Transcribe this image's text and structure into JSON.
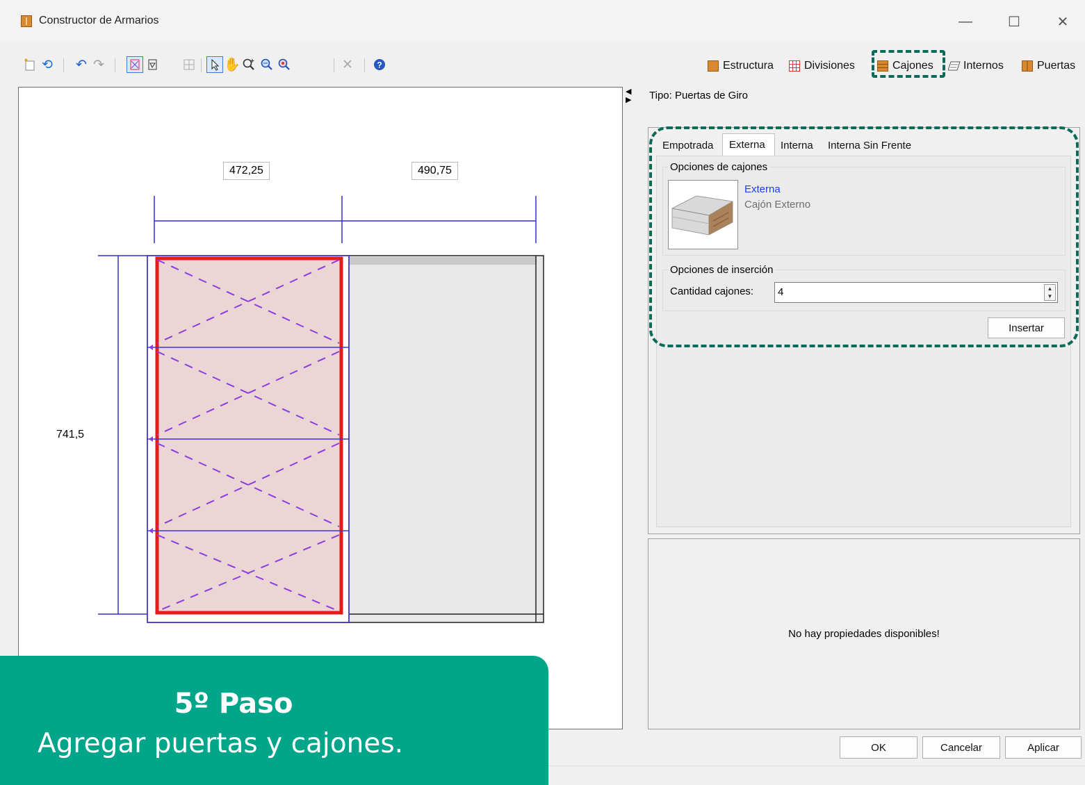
{
  "window": {
    "title": "Constructor de Armarios",
    "minimize": "—",
    "maximize": "☐",
    "close": "✕"
  },
  "toolbar": {
    "tabs": [
      {
        "label": "Estructura"
      },
      {
        "label": "Divisiones"
      },
      {
        "label": "Cajones"
      },
      {
        "label": "Internos"
      },
      {
        "label": "Puertas"
      }
    ]
  },
  "canvas": {
    "dim_top_left": "472,25",
    "dim_top_right": "490,75",
    "dim_left": "741,5"
  },
  "panel": {
    "tipo": "Tipo: Puertas de Giro",
    "tabs": [
      "Empotrada",
      "Externa",
      "Interna",
      "Interna Sin Frente"
    ],
    "active_tab": "Externa",
    "group_drawer_options": "Opciones de cajones",
    "drawer_name": "Externa",
    "drawer_desc": "Cajón Externo",
    "group_insert_options": "Opciones de inserción",
    "qty_label": "Cantidad cajones:",
    "qty_value": "4",
    "insert_button": "Insertar",
    "props_message": "No hay propiedades disponibles!"
  },
  "buttons": {
    "ok": "OK",
    "cancel": "Cancelar",
    "apply": "Aplicar"
  },
  "callout": {
    "title": "5º Paso",
    "text": "Agregar puertas y cajones."
  },
  "colors": {
    "callout": "#00a58a",
    "highlight": "#0c6b57",
    "selection_red": "#e21b1b",
    "dimension_blue": "#2f2fd6",
    "drawer_purple": "#8a3ee0"
  }
}
